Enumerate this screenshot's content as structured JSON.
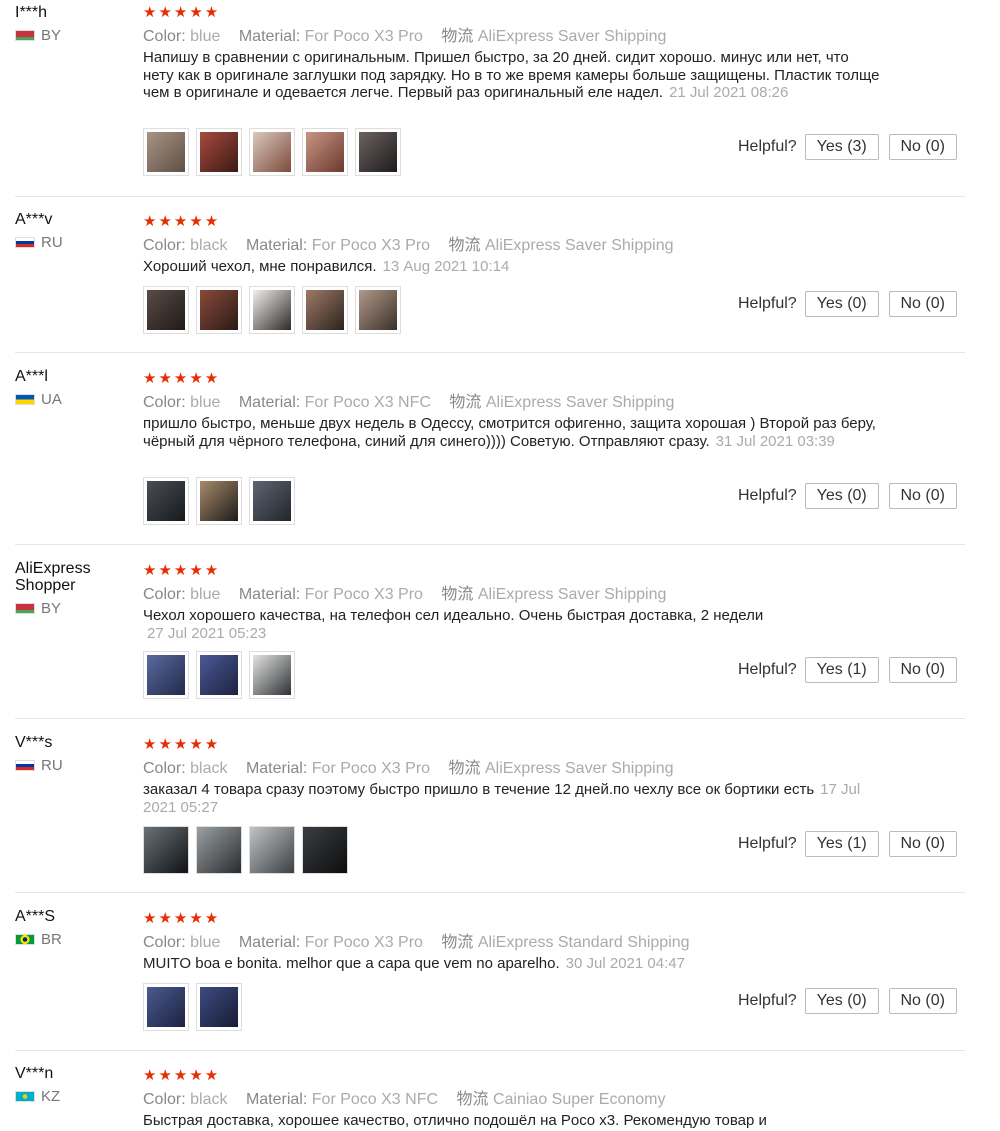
{
  "labels": {
    "color": "Color:",
    "material": "Material:",
    "logistics": "物流",
    "helpful": "Helpful?",
    "stars": "★★★★★"
  },
  "reviews": [
    {
      "user": "I***h",
      "country": "BY",
      "flag_colors": [
        "#c8313e",
        "#4aa657"
      ],
      "color": "blue",
      "material": "For Poco X3 Pro",
      "shipping": "AliExpress Saver Shipping",
      "text": "Напишу в сравнении с оригинальным. Пришел быстро, за 20 дней. сидит хорошо. минус или нет, что нету как в оригинале заглушки под зарядку. Но в то же время камеры больше защищены. Пластик толще чем в оригинале и одевается легче. Первый раз оригинальный еле надел.",
      "date": "21 Jul 2021 08:26",
      "yes": "Yes (3)",
      "no": "No (0)",
      "thumbs": [
        "#6d5f55",
        "#7a2c25",
        "#9c7d6b",
        "#8f5a48",
        "#3b3535"
      ]
    },
    {
      "user": "A***v",
      "country": "RU",
      "flag_colors": [
        "#ffffff",
        "#0039a6",
        "#d52b1e"
      ],
      "color": "black",
      "material": "For Poco X3 Pro",
      "shipping": "AliExpress Saver Shipping",
      "text": "Хороший чехол, мне понравился.",
      "date": "13 Aug 2021 10:14",
      "yes": "Yes (0)",
      "no": "No (0)",
      "thumbs": [
        "#3d3430",
        "#6a3a2e",
        "#d8d4d0",
        "#4e3d33",
        "#7b6759"
      ]
    },
    {
      "user": "A***l",
      "country": "UA",
      "flag_colors": [
        "#0057b7",
        "#ffd700"
      ],
      "color": "blue",
      "material": "For Poco X3 NFC",
      "shipping": "AliExpress Saver Shipping",
      "text": "пришло быстро, меньше двух недель в Одессу, смотрится офигенно, защита хорошая ) Второй раз беру, чёрный для чёрного телефона, синий для синего)))) Советую. Отправляют сразу.",
      "date": "31 Jul 2021 03:39",
      "yes": "Yes (0)",
      "no": "No (0)",
      "thumbs": [
        "#2e3236",
        "#5a4a3a",
        "#3c4048"
      ]
    },
    {
      "user": "AliExpress Shopper",
      "country": "BY",
      "flag_colors": [
        "#c8313e",
        "#4aa657"
      ],
      "color": "blue",
      "material": "For Poco X3 Pro",
      "shipping": "AliExpress Saver Shipping",
      "text": "Чехол хорошего качества, на телефон сел идеально. Очень быстрая доставка, 2 недели",
      "date": "27 Jul 2021 05:23",
      "yes": "Yes (1)",
      "no": "No (0)",
      "thumbs": [
        "#3a4a7c",
        "#34427a",
        "#4d5156"
      ]
    },
    {
      "user": "V***s",
      "country": "RU",
      "flag_colors": [
        "#ffffff",
        "#0039a6",
        "#d52b1e"
      ],
      "color": "black",
      "material": "For Poco X3 Pro",
      "shipping": "AliExpress Saver Shipping",
      "text": "заказал 4 товара сразу поэтому быстро пришло в течение 12 дней.по чехлу все ок бортики есть",
      "date": "17 Jul 2021 05:27",
      "yes": "Yes (1)",
      "no": "No (0)",
      "thumbs": [
        "#2c3236",
        "#4b4e52",
        "#6f7275",
        "#1e2024"
      ]
    },
    {
      "user": "A***S",
      "country": "BR",
      "flag_colors": [
        "#009c3b",
        "#ffdf00",
        "#002776"
      ],
      "color": "blue",
      "material": "For Poco X3 Pro",
      "shipping": "AliExpress Standard Shipping",
      "text": "MUITO boa e bonita. melhor que a capa que vem no aparelho.",
      "date": "30 Jul 2021 04:47",
      "yes": "Yes (0)",
      "no": "No (0)",
      "thumbs": [
        "#2e3f72",
        "#27345e"
      ]
    },
    {
      "user": "V***n",
      "country": "KZ",
      "flag_colors": [
        "#00afca",
        "#fec50c"
      ],
      "color": "black",
      "material": "For Poco X3 NFC",
      "shipping": "Cainiao Super Economy",
      "text": "Быстрая доставка, хорошее качество, отлично подошёл на Poco x3. Рекомендую товар и",
      "date": "",
      "yes": "",
      "no": "",
      "thumbs": []
    }
  ]
}
